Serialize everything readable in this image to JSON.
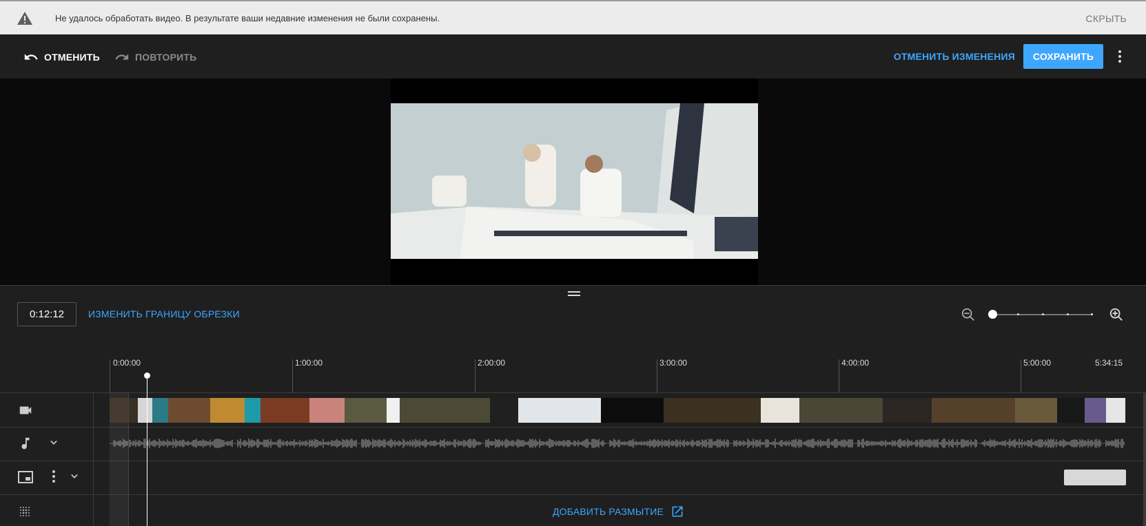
{
  "warning": {
    "message": "Не удалось обработать видео. В результате ваши недавние изменения не были сохранены.",
    "hide_label": "СКРЫТЬ",
    "icon": "warning-icon"
  },
  "toolbar": {
    "undo_label": "ОТМЕНИТЬ",
    "redo_label": "ПОВТОРИТЬ",
    "discard_label": "ОТМЕНИТЬ ИЗМЕНЕНИЯ",
    "save_label": "СОХРАНИТЬ",
    "more_icon": "more-vert-icon"
  },
  "editor": {
    "current_time": "0:12:12",
    "trim_label": "ИЗМЕНИТЬ ГРАНИЦУ ОБРЕЗКИ",
    "zoom_level": 0
  },
  "ruler": {
    "labels": [
      "0:00:00",
      "1:00:00",
      "2:00:00",
      "3:00:00",
      "4:00:00",
      "5:00:00",
      "5:34:15"
    ]
  },
  "tracks": {
    "video_icon": "videocam-icon",
    "audio_icon": "music-note-icon",
    "text_icon": "end-screen-icon",
    "blur_icon": "blur-icon",
    "add_blur_label": "ДОБАВИТЬ РАЗМЫТИЕ"
  },
  "colors": {
    "accent": "#3ea6ff",
    "background": "#1f1f1f",
    "warning_bg": "#ececec"
  }
}
